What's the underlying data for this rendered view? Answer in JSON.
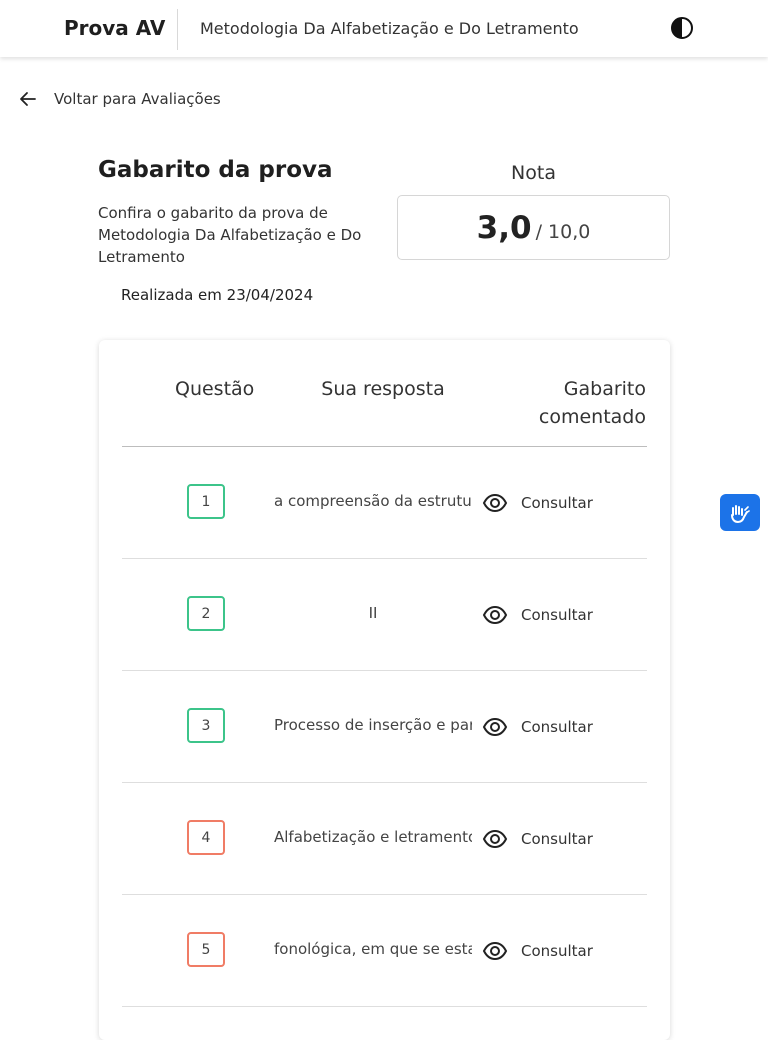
{
  "header": {
    "brand": "Prova AV",
    "course": "Metodologia Da Alfabetização e Do Letramento",
    "contrast_icon": "contrast-icon"
  },
  "nav": {
    "back_label": "Voltar para Avaliações",
    "back_icon": "arrow-left-icon"
  },
  "intro": {
    "title": "Gabarito da prova",
    "subtitle": "Confira o gabarito da prova de Metodologia Da Alfabetização e Do Letramento",
    "done_date": "Realizada em 23/04/2024"
  },
  "grade": {
    "label": "Nota",
    "value": "3,0",
    "total": "/ 10,0"
  },
  "table": {
    "headers": {
      "question": "Questão",
      "answer": "Sua resposta",
      "key": "Gabarito comentado"
    },
    "rows": [
      {
        "number": "1",
        "status": "correct",
        "answer": "a compreensão da estrutura",
        "action": "Consultar"
      },
      {
        "number": "2",
        "status": "correct",
        "answer": "II",
        "action": "Consultar"
      },
      {
        "number": "3",
        "status": "correct",
        "answer": "Processo de inserção e par",
        "action": "Consultar"
      },
      {
        "number": "4",
        "status": "wrong",
        "answer": "Alfabetização e letramento",
        "action": "Consultar"
      },
      {
        "number": "5",
        "status": "wrong",
        "answer": "fonológica, em que se estal",
        "action": "Consultar"
      }
    ]
  },
  "colors": {
    "correct": "#3cc48a",
    "wrong": "#f07c65",
    "accessibility": "#1c73e8"
  },
  "accessibility_icon": "sign-language-hands-icon"
}
